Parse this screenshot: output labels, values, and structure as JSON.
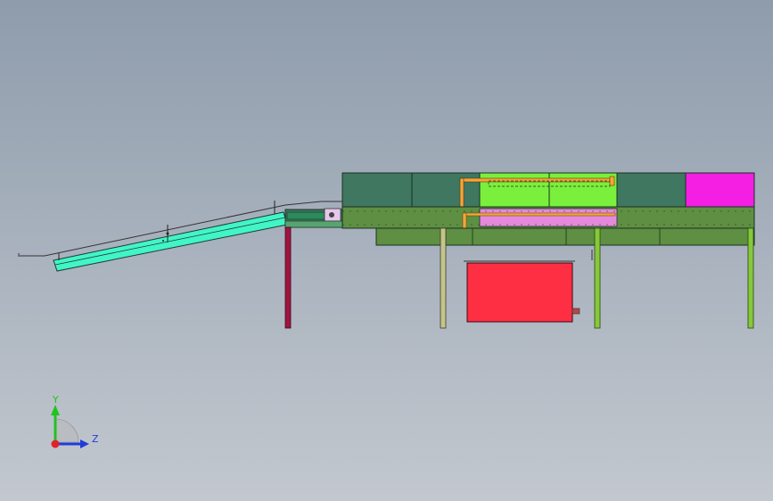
{
  "view": {
    "triad": {
      "y_label": "Y",
      "z_label": "Z",
      "y_color": "#21c321",
      "z_color": "#1f3cd8",
      "x_color": "#e0222a"
    }
  },
  "colors": {
    "background_top": "#8e9cac",
    "background_bottom": "#c3c8cf",
    "conveyor_incline": "#41f5c6",
    "frame_green": "#5e8f42",
    "chamber_dark": "#3f7761",
    "chamber_lime": "#7af03c",
    "chamber_magenta": "#f51ee3",
    "tank_red": "#fe2f43",
    "pipe_orange": "#f5a637",
    "leg_crimson": "#a01442",
    "leg_khaki": "#c4c48c",
    "leg_green": "#86c83a"
  }
}
